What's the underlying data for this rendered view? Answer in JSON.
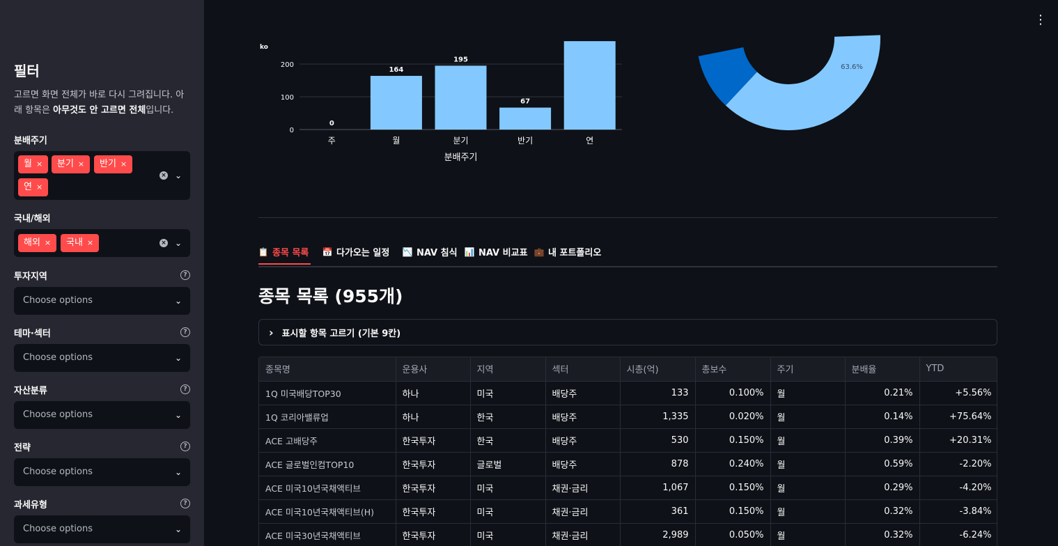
{
  "sidebar": {
    "title": "필터",
    "desc_a": "고르면 화면 전체가 바로 다시 그려집니다. 아래 항목은 ",
    "desc_b": "아무것도 안 고르면 전체",
    "desc_c": "입니다.",
    "filters": [
      {
        "label": "분배주기",
        "chips": [
          "월",
          "분기",
          "반기",
          "연"
        ]
      },
      {
        "label": "국내/해외",
        "chips": [
          "해외",
          "국내"
        ]
      },
      {
        "label": "투자지역",
        "placeholder": "Choose options"
      },
      {
        "label": "테마·섹터",
        "placeholder": "Choose options"
      },
      {
        "label": "자산분류",
        "placeholder": "Choose options"
      },
      {
        "label": "전략",
        "placeholder": "Choose options"
      },
      {
        "label": "과세유형",
        "placeholder": "Choose options"
      }
    ],
    "help_glyph": "?",
    "chip_remove": "×",
    "clear_glyph": "×",
    "chevron": "⌄"
  },
  "menu_glyph": "⋮",
  "chart_data": [
    {
      "type": "bar",
      "categories": [
        "주",
        "월",
        "분기",
        "반기",
        "연"
      ],
      "values": [
        0,
        164,
        195,
        67,
        270
      ],
      "data_labels": [
        "0",
        "164",
        "195",
        "67",
        ""
      ],
      "xlabel": "분배주기",
      "ylabel": "ko",
      "yticks": [
        0,
        100,
        200
      ],
      "ylim": [
        0,
        270
      ],
      "grid": true,
      "color": "#83c9ff"
    },
    {
      "type": "pie",
      "slices": [
        {
          "value": 63.6,
          "label": "63.6%",
          "color": "#83c9ff"
        },
        {
          "value": 11.0,
          "label": "",
          "color": "#0068c9"
        }
      ]
    }
  ],
  "tabs": [
    {
      "icon": "📋",
      "label": "종목 목록",
      "active": true
    },
    {
      "icon": "📅",
      "label": "다가오는 일정"
    },
    {
      "icon": "📉",
      "label": "NAV 침식"
    },
    {
      "icon": "📊",
      "label": "NAV 비교표"
    },
    {
      "icon": "💼",
      "label": "내 포트폴리오"
    }
  ],
  "section_title": "종목 목록 (955개)",
  "expander_label": "표시할 항목 고르기 (기본 9칸)",
  "expander_chevron": "›",
  "table": {
    "columns": [
      "종목명",
      "운용사",
      "지역",
      "섹터",
      "시총(억)",
      "총보수",
      "주기",
      "분배율",
      "YTD"
    ],
    "rows": [
      [
        "1Q 미국배당TOP30",
        "하나",
        "미국",
        "배당주",
        "133",
        "0.100%",
        "월",
        "0.21%",
        "+5.56%"
      ],
      [
        "1Q 코리아밸류업",
        "하나",
        "한국",
        "배당주",
        "1,335",
        "0.020%",
        "월",
        "0.14%",
        "+75.64%"
      ],
      [
        "ACE 고배당주",
        "한국투자",
        "한국",
        "배당주",
        "530",
        "0.150%",
        "월",
        "0.39%",
        "+20.31%"
      ],
      [
        "ACE 글로벌인컴TOP10",
        "한국투자",
        "글로벌",
        "배당주",
        "878",
        "0.240%",
        "월",
        "0.59%",
        "-2.20%"
      ],
      [
        "ACE 미국10년국채액티브",
        "한국투자",
        "미국",
        "채권·금리",
        "1,067",
        "0.150%",
        "월",
        "0.29%",
        "-4.20%"
      ],
      [
        "ACE 미국10년국채액티브(H)",
        "한국투자",
        "미국",
        "채권·금리",
        "361",
        "0.150%",
        "월",
        "0.32%",
        "-3.84%"
      ],
      [
        "ACE 미국30년국채액티브",
        "한국투자",
        "미국",
        "채권·금리",
        "2,989",
        "0.050%",
        "월",
        "0.32%",
        "-6.24%"
      ]
    ]
  },
  "colors": {
    "accent": "#ff4b4b",
    "sidebar_bg": "#262730",
    "main_bg": "#0e1117",
    "bar": "#83c9ff",
    "pie_dark": "#0068c9"
  }
}
